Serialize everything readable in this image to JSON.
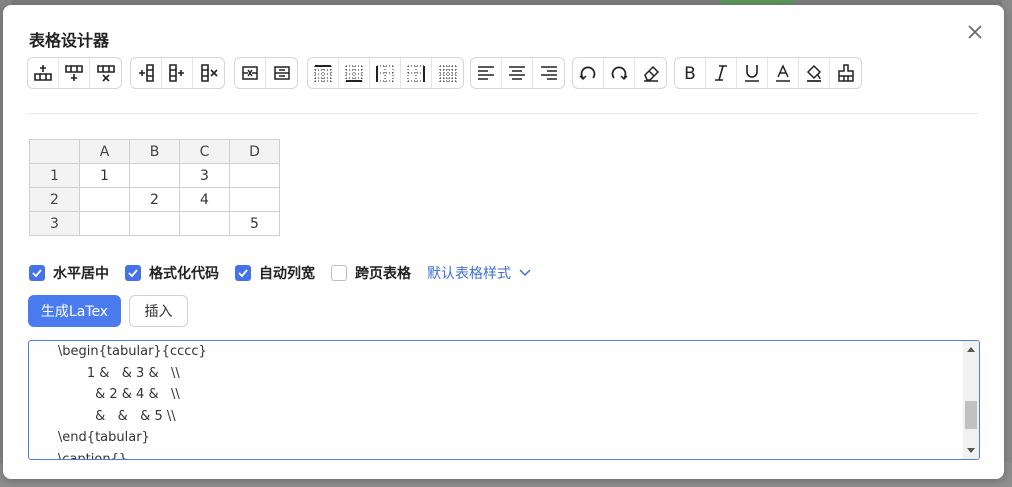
{
  "dialog": {
    "title": "表格设计器"
  },
  "toolbar_groups": [
    {
      "name": "rows",
      "icons": [
        "insert-row-above-icon",
        "insert-row-below-icon",
        "delete-row-icon"
      ]
    },
    {
      "name": "columns",
      "icons": [
        "insert-column-left-icon",
        "insert-column-right-icon",
        "delete-column-icon"
      ]
    },
    {
      "name": "merge",
      "icons": [
        "merge-cells-icon",
        "split-cells-icon"
      ]
    },
    {
      "name": "borders",
      "icons": [
        "border-top-icon",
        "border-bottom-icon",
        "border-vertical-icon",
        "border-all-icon",
        "border-none-icon"
      ]
    },
    {
      "name": "align",
      "icons": [
        "align-left-icon",
        "align-center-icon",
        "align-right-icon"
      ]
    },
    {
      "name": "history",
      "icons": [
        "undo-icon",
        "redo-icon",
        "eraser-icon"
      ]
    },
    {
      "name": "format",
      "icons": [
        "bold-icon",
        "italic-icon",
        "underline-icon",
        "font-color-icon",
        "fill-color-icon",
        "clear-format-icon"
      ]
    }
  ],
  "grid": {
    "columns": [
      "A",
      "B",
      "C",
      "D"
    ],
    "rows": [
      {
        "label": "1",
        "cells": [
          "1",
          "",
          "3",
          ""
        ]
      },
      {
        "label": "2",
        "cells": [
          "",
          "2",
          "4",
          ""
        ]
      },
      {
        "label": "3",
        "cells": [
          "",
          "",
          "",
          "5"
        ]
      }
    ]
  },
  "options": {
    "center": {
      "label": "水平居中",
      "checked": true
    },
    "format_code": {
      "label": "格式化代码",
      "checked": true
    },
    "auto_col": {
      "label": "自动列宽",
      "checked": true
    },
    "longtable": {
      "label": "跨页表格",
      "checked": false
    },
    "style_label": "默认表格样式"
  },
  "buttons": {
    "generate": "生成LaTex",
    "insert": "插入"
  },
  "code": {
    "lines": [
      "       \\begin{tabular}{cccc}",
      "              1 &   & 3 &   \\\\",
      "                & 2 & 4 &   \\\\",
      "                &   &   & 5 \\\\",
      "       \\end{tabular}",
      "       \\caption{}"
    ]
  },
  "colors": {
    "accent": "#4a7cf0",
    "link": "#3d6fd6"
  }
}
